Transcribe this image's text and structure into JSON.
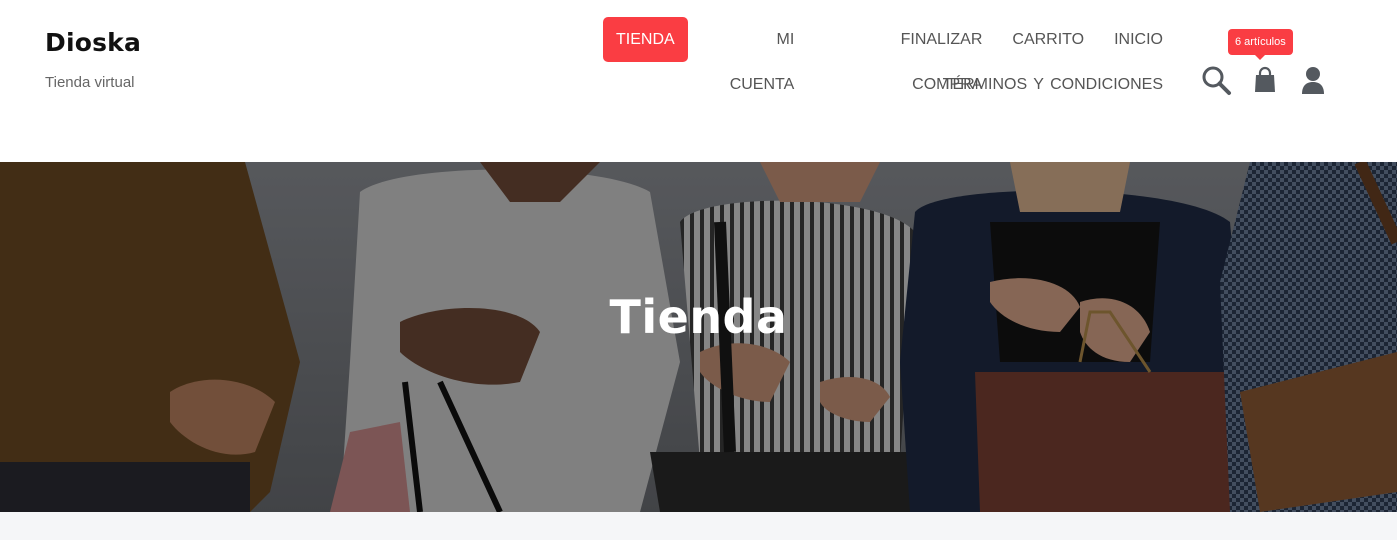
{
  "site": {
    "title": "Dioska",
    "tagline": "Tienda virtual"
  },
  "nav": {
    "row1": [
      {
        "label": "TIENDA",
        "active": true
      },
      {
        "label": "MI CUENTA",
        "active": false
      },
      {
        "label": "FINALIZAR COMPRA",
        "active": false
      },
      {
        "label": "CARRITO",
        "active": false
      },
      {
        "label": "INICIO",
        "active": false
      }
    ],
    "row2": [
      {
        "label": "TÉRMINOS Y CONDICIONES",
        "active": false
      }
    ]
  },
  "icons": {
    "search": "search-icon",
    "cart": "shopping-bag-icon",
    "account": "user-icon"
  },
  "cart": {
    "badge": "6 artículos"
  },
  "hero": {
    "title": "Tienda"
  },
  "colors": {
    "accent": "#fa3d43",
    "nav_text": "#555555",
    "icon": "#54595f",
    "content_bg": "#f5f6f8"
  }
}
